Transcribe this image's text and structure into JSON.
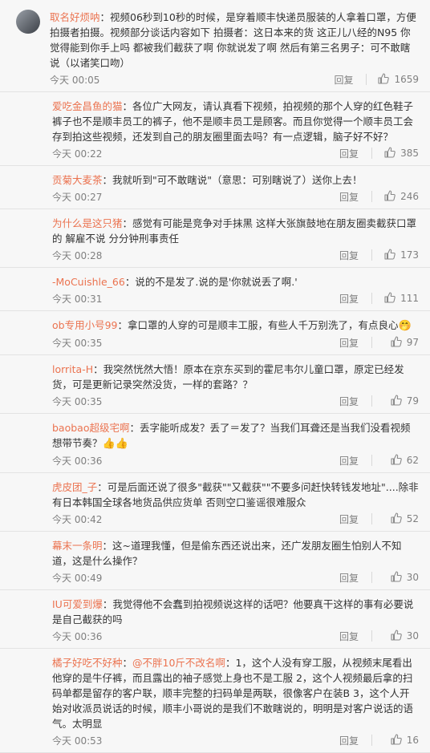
{
  "comments": [
    {
      "user": "取名好烦呐",
      "sep": "：",
      "text": "视频06秒到10秒的时候，是穿着顺丰快递员服装的人拿着口罩，方便拍摄者拍摄。视频部分谈话内容如下 拍摄者：这日本来的货 这正儿八经的N95 你觉得能到你手上吗 都被我们截获了啊 你就说发了啊 然后有第三名男子：可不敢瞎说（以诸笑口吻）",
      "time": "今天 00:05",
      "reply": "回复",
      "likes": "1659"
    },
    {
      "user": "爱吃金昌鱼的猫",
      "sep": "：",
      "text": "各位广大网友，请认真看下视频，拍视频的那个人穿的红色鞋子裤子也不是顺丰员工的裤子，他不是顺丰员工是顾客。而且你觉得一个顺丰员工会存到拍这些视频，还发到自己的朋友圈里面去吗？有一点逻辑，脑子好不好？",
      "time": "今天 00:22",
      "reply": "回复",
      "likes": "385"
    },
    {
      "user": "贡菊大麦茶",
      "sep": "：",
      "text": "我就听到\"可不敢瞎说\"（意思：可别瞎说了）送你上去！",
      "time": "今天 00:27",
      "reply": "回复",
      "likes": "246"
    },
    {
      "user": "为什么是这只猪",
      "sep": "：",
      "text": "感觉有可能是竞争对手抹黑 这样大张旗鼓地在朋友圈卖截获口罩的 解雇不说 分分钟刑事责任",
      "time": "今天 00:28",
      "reply": "回复",
      "likes": "173"
    },
    {
      "user": "-MoCuishle_66",
      "sep": "：",
      "text": "说的不是发了.说的是'你就说丢了啊.'",
      "time": "今天 00:31",
      "reply": "回复",
      "likes": "111"
    },
    {
      "user": "ob专用小号99",
      "sep": "：",
      "text": "拿口罩的人穿的可是顺丰工服，有些人千万别洗了，有点良心",
      "emoji": "🤭",
      "time": "今天 00:35",
      "reply": "回复",
      "likes": "97"
    },
    {
      "user": "lorrita-H",
      "sep": "：",
      "text": "我突然恍然大悟！原本在京东买到的霍尼韦尔儿童口罩，原定已经发货，可是更新记录突然没货，一样的套路？？",
      "time": "今天 00:35",
      "reply": "回复",
      "likes": "79"
    },
    {
      "user": "baobao超级宅啊",
      "sep": "：",
      "text": "丢字能听成发？丢了＝发了？当我们耳聋还是当我们没看视频想带节奏？",
      "emoji": "👍👍",
      "time": "今天 00:36",
      "reply": "回复",
      "likes": "62"
    },
    {
      "user": "虎皮团_子",
      "sep": "：",
      "text": "可是后面还说了很多\"截获\"\"又截获\"\"不要多问赶快转钱发地址\"....除非有日本韩国全球各地货品供应货单 否则空口鉴谣很难服众",
      "time": "今天 00:42",
      "reply": "回复",
      "likes": "52"
    },
    {
      "user": "幕末一条明",
      "sep": "：",
      "text": "这~道理我懂，但是偷东西还说出来，还广发朋友圈生怕别人不知道，这是什么操作？",
      "time": "今天 00:49",
      "reply": "回复",
      "likes": "30"
    },
    {
      "user": "IU可爱到爆",
      "sep": "：",
      "text": "我觉得他不会蠢到拍视频说这样的话吧？他要真干这样的事有必要说是自己截获的吗",
      "time": "今天 00:36",
      "reply": "回复",
      "likes": "30"
    },
    {
      "user": "橘子好吃不好种",
      "sep": "：",
      "mention": "@不胖10斤不改名啊",
      "text": "：1，这个人没有穿工服，从视频末尾看出他穿的是牛仔裤，而且露出的袖子感觉上身也不是工服 2，这个人视频最后拿的扫码单都是留存的客户联，顺丰完整的扫码单是两联，很像客户在装B 3，这个人开始对收派员说话的时候，顺丰小哥说的是我们不敢瞎说的，明明是对客户说话的语气。太明显",
      "time": "今天 00:53",
      "reply": "回复",
      "likes": "16"
    }
  ]
}
